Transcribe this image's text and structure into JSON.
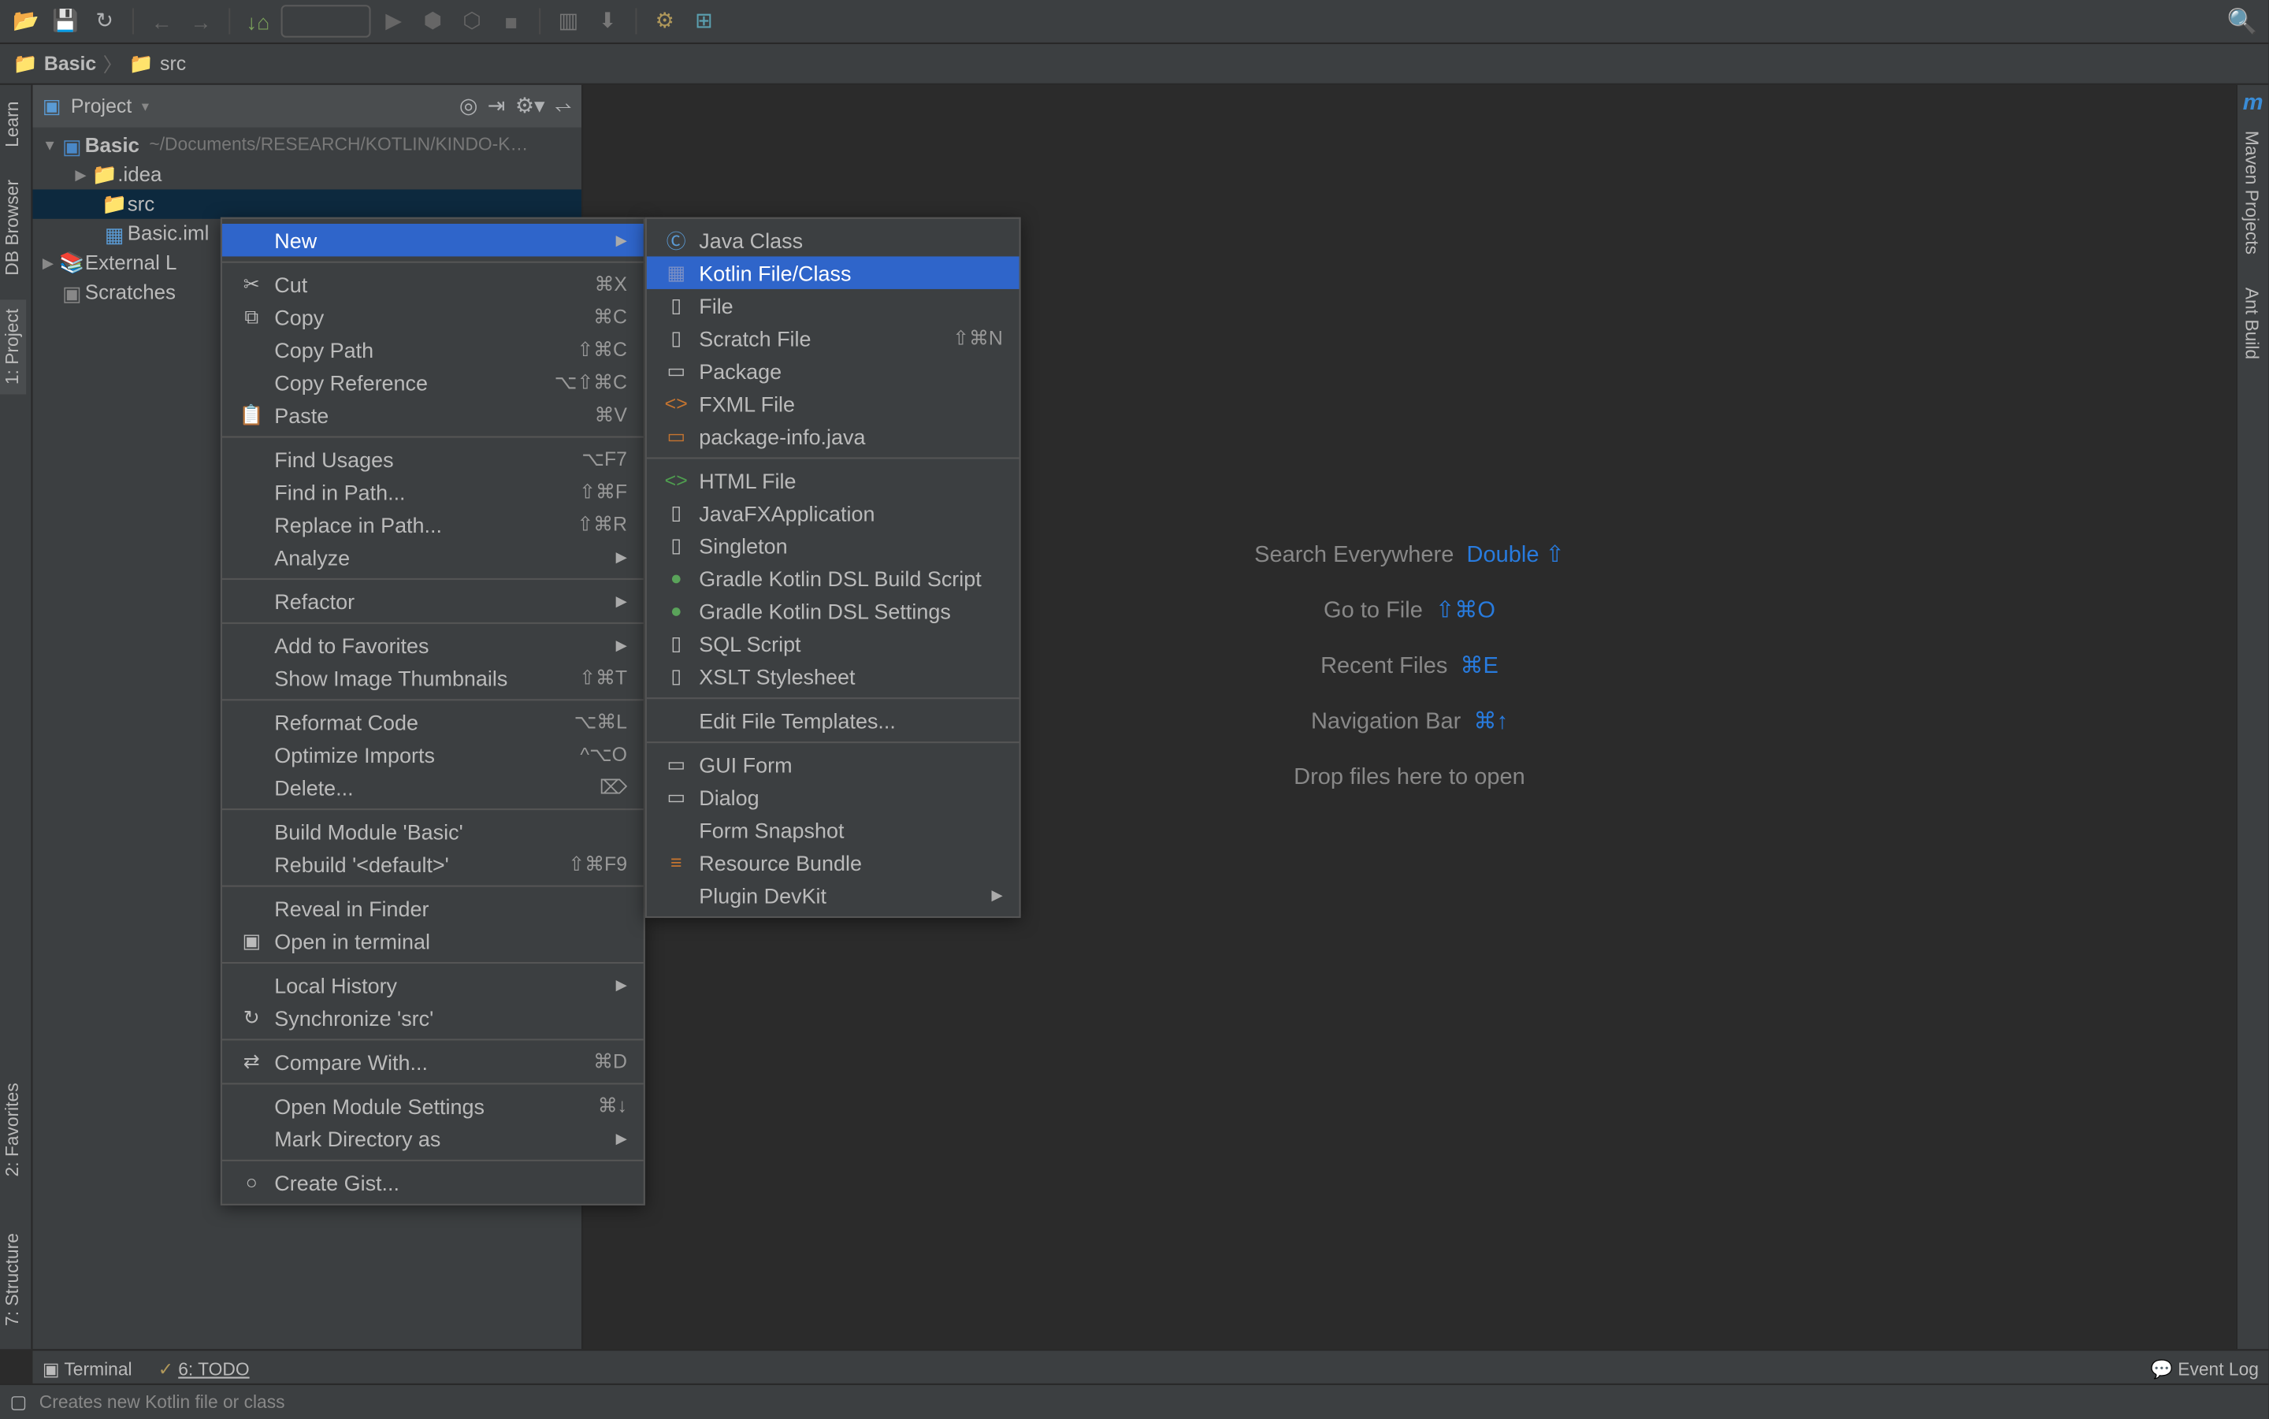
{
  "toolbar": {
    "run_combo": ""
  },
  "breadcrumb": {
    "items": [
      "Basic",
      "src"
    ]
  },
  "project": {
    "title": "Project",
    "tree": {
      "root": "Basic",
      "root_path": "~/Documents/RESEARCH/KOTLIN/KINDO-K…",
      "idea": ".idea",
      "src": "src",
      "iml": "Basic.iml",
      "ext": "External L",
      "scratches": "Scratches"
    }
  },
  "left_tabs": {
    "learn": "Learn",
    "db": "DB Browser",
    "project": "1: Project",
    "favorites": "2: Favorites",
    "structure": "7: Structure"
  },
  "right_tabs": {
    "maven": "Maven Projects",
    "ant": "Ant Build"
  },
  "welcome": {
    "l1a": "Search Everywhere",
    "l1b": "Double ⇧",
    "l2a": "Go to File",
    "l2b": "⇧⌘O",
    "l3a": "Recent Files",
    "l3b": "⌘E",
    "l4a": "Navigation Bar",
    "l4b": "⌘↑",
    "l5": "Drop files here to open"
  },
  "context_menu": [
    {
      "label": "New",
      "arrow": true,
      "highlight": true,
      "icon": ""
    },
    {
      "sep": true
    },
    {
      "label": "Cut",
      "short": "⌘X",
      "icon": "✂"
    },
    {
      "label": "Copy",
      "short": "⌘C",
      "icon": "⧉"
    },
    {
      "label": "Copy Path",
      "short": "⇧⌘C"
    },
    {
      "label": "Copy Reference",
      "short": "⌥⇧⌘C"
    },
    {
      "label": "Paste",
      "short": "⌘V",
      "icon": "📋"
    },
    {
      "sep": true
    },
    {
      "label": "Find Usages",
      "short": "⌥F7"
    },
    {
      "label": "Find in Path...",
      "short": "⇧⌘F"
    },
    {
      "label": "Replace in Path...",
      "short": "⇧⌘R"
    },
    {
      "label": "Analyze",
      "arrow": true
    },
    {
      "sep": true
    },
    {
      "label": "Refactor",
      "arrow": true
    },
    {
      "sep": true
    },
    {
      "label": "Add to Favorites",
      "arrow": true
    },
    {
      "label": "Show Image Thumbnails",
      "short": "⇧⌘T"
    },
    {
      "sep": true
    },
    {
      "label": "Reformat Code",
      "short": "⌥⌘L"
    },
    {
      "label": "Optimize Imports",
      "short": "^⌥O"
    },
    {
      "label": "Delete...",
      "short": "⌦"
    },
    {
      "sep": true
    },
    {
      "label": "Build Module 'Basic'"
    },
    {
      "label": "Rebuild '<default>'",
      "short": "⇧⌘F9"
    },
    {
      "sep": true
    },
    {
      "label": "Reveal in Finder"
    },
    {
      "label": "Open in terminal",
      "icon": "▣"
    },
    {
      "sep": true
    },
    {
      "label": "Local History",
      "arrow": true
    },
    {
      "label": "Synchronize 'src'",
      "icon": "↻"
    },
    {
      "sep": true
    },
    {
      "label": "Compare With...",
      "short": "⌘D",
      "icon": "⇄"
    },
    {
      "sep": true
    },
    {
      "label": "Open Module Settings",
      "short": "⌘↓"
    },
    {
      "label": "Mark Directory as",
      "arrow": true
    },
    {
      "sep": true
    },
    {
      "label": "Create Gist...",
      "icon": "○"
    }
  ],
  "submenu": [
    {
      "label": "Java Class",
      "icon": "Ⓒ",
      "color": "#5b9bd5"
    },
    {
      "label": "Kotlin File/Class",
      "highlight": true,
      "icon": "▦",
      "color": "#7a8fc5"
    },
    {
      "label": "File",
      "icon": "▯"
    },
    {
      "label": "Scratch File",
      "short": "⇧⌘N",
      "icon": "▯"
    },
    {
      "label": "Package",
      "icon": "▭"
    },
    {
      "label": "FXML File",
      "icon": "<>",
      "color": "#c57430"
    },
    {
      "label": "package-info.java",
      "icon": "▭",
      "color": "#c57430"
    },
    {
      "sep": true
    },
    {
      "label": "HTML File",
      "icon": "<>",
      "color": "#4f9e4f"
    },
    {
      "label": "JavaFXApplication",
      "icon": "▯"
    },
    {
      "label": "Singleton",
      "icon": "▯"
    },
    {
      "label": "Gradle Kotlin DSL Build Script",
      "icon": "●",
      "color": "#5aa35a"
    },
    {
      "label": "Gradle Kotlin DSL Settings",
      "icon": "●",
      "color": "#5aa35a"
    },
    {
      "label": "SQL Script",
      "icon": "▯"
    },
    {
      "label": "XSLT Stylesheet",
      "icon": "▯"
    },
    {
      "sep": true
    },
    {
      "label": "Edit File Templates..."
    },
    {
      "sep": true
    },
    {
      "label": "GUI Form",
      "icon": "▭"
    },
    {
      "label": "Dialog",
      "icon": "▭"
    },
    {
      "label": "Form Snapshot"
    },
    {
      "label": "Resource Bundle",
      "icon": "≡",
      "color": "#c57430"
    },
    {
      "label": "Plugin DevKit",
      "arrow": true
    }
  ],
  "bottom": {
    "terminal": "Terminal",
    "todo": "6: TODO",
    "eventlog": "Event Log"
  },
  "status_text": "Creates new Kotlin file or class"
}
